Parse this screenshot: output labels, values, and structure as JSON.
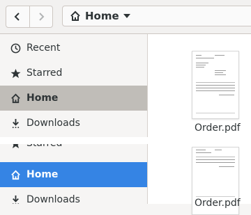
{
  "header": {
    "back_icon": "go-previous-icon",
    "forward_icon": "go-next-icon",
    "path": {
      "icon": "home-icon",
      "label": "Home",
      "caret": "pan-down-icon"
    }
  },
  "sidebar": {
    "items": [
      {
        "label": "Recent",
        "icon": "clock-icon"
      },
      {
        "label": "Starred",
        "icon": "star-icon"
      },
      {
        "label": "Home",
        "icon": "home-icon",
        "selected": true
      },
      {
        "label": "Downloads",
        "icon": "download-icon"
      }
    ]
  },
  "drag_ghost": {
    "items": [
      {
        "label": "Starred",
        "icon": "star-icon"
      },
      {
        "label": "Home",
        "icon": "home-icon",
        "selected": true
      },
      {
        "label": "Downloads",
        "icon": "download-icon"
      }
    ]
  },
  "files": [
    {
      "name": "Order.pdf",
      "icon": "pdf-thumbnail"
    },
    {
      "name": "Order.pdf",
      "icon": "pdf-thumbnail"
    }
  ],
  "colors": {
    "selection": "#3584e4",
    "sidebar_selected": "#c0bdb8"
  }
}
